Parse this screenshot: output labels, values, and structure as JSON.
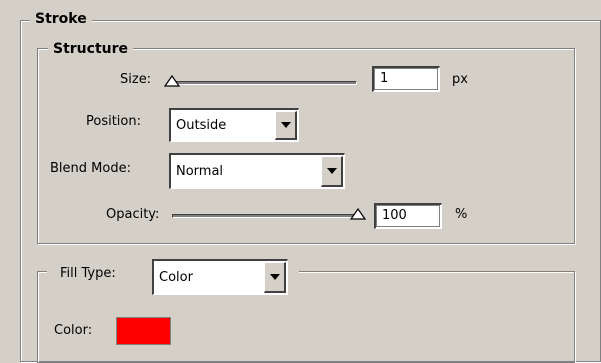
{
  "stroke": {
    "legend": "Stroke",
    "structure": {
      "legend": "Structure",
      "size": {
        "label": "Size:",
        "value": "1",
        "unit": "px",
        "slider_fraction": 0.01
      },
      "position": {
        "label": "Position:",
        "value": "Outside"
      },
      "blend_mode": {
        "label": "Blend Mode:",
        "value": "Normal"
      },
      "opacity": {
        "label": "Opacity:",
        "value": "100",
        "unit": "%",
        "slider_fraction": 1.0
      }
    },
    "fill": {
      "type_label": "Fill Type:",
      "type_value": "Color",
      "color_label": "Color:",
      "color_value": "#ff0000"
    }
  },
  "icons": {
    "slider_thumb": "triangle-slider-thumb",
    "dropdown": "chevron-down-icon"
  }
}
